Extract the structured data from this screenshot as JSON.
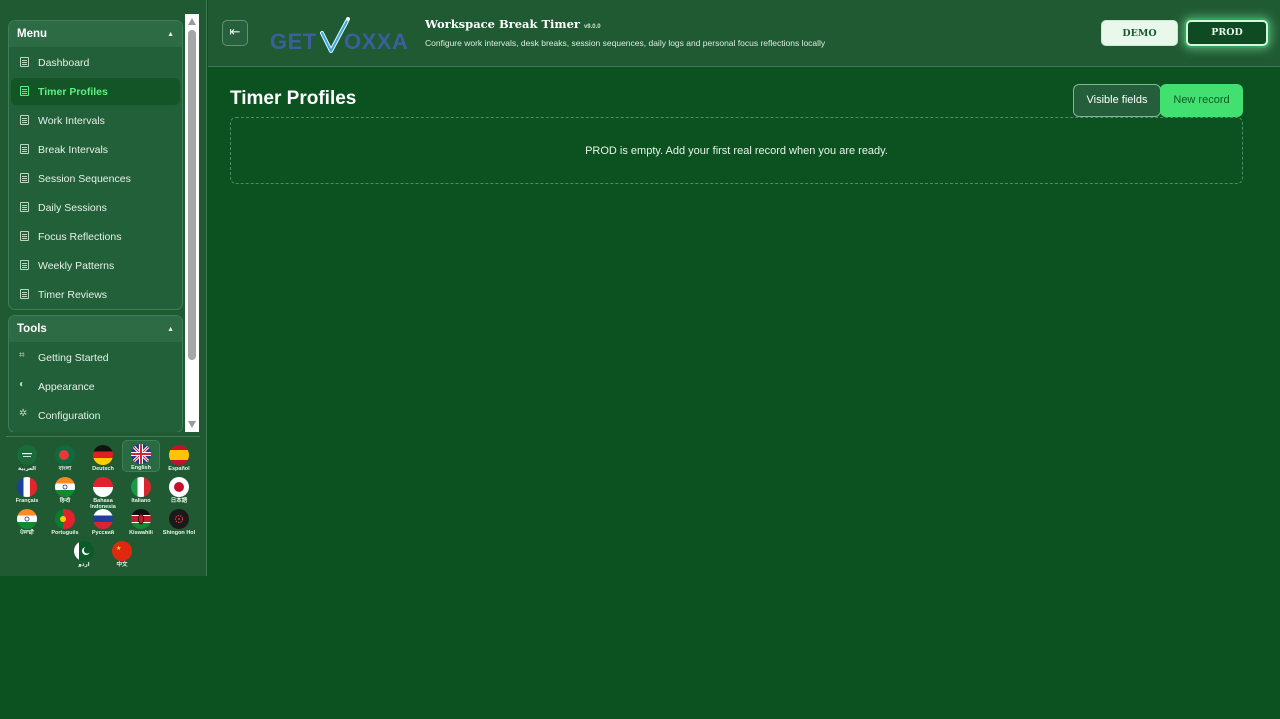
{
  "sidebar": {
    "menu": {
      "title": "Menu",
      "items": [
        {
          "label": "Dashboard"
        },
        {
          "label": "Timer Profiles",
          "active": true
        },
        {
          "label": "Work Intervals"
        },
        {
          "label": "Break Intervals"
        },
        {
          "label": "Session Sequences"
        },
        {
          "label": "Daily Sessions"
        },
        {
          "label": "Focus Reflections"
        },
        {
          "label": "Weekly Patterns"
        },
        {
          "label": "Timer Reviews"
        }
      ]
    },
    "tools": {
      "title": "Tools",
      "items": [
        {
          "label": "Getting Started",
          "icon": "start-icon"
        },
        {
          "label": "Appearance",
          "icon": "palette-icon"
        },
        {
          "label": "Configuration",
          "icon": "gear-icon"
        }
      ]
    },
    "languages": [
      {
        "label": "العربية",
        "flag": "saudi-arabia"
      },
      {
        "label": "বাংলা",
        "flag": "bangladesh"
      },
      {
        "label": "Deutsch",
        "flag": "germany"
      },
      {
        "label": "English",
        "flag": "united-kingdom",
        "active": true
      },
      {
        "label": "Español",
        "flag": "spain"
      },
      {
        "label": "Français",
        "flag": "france"
      },
      {
        "label": "हिन्दी",
        "flag": "india"
      },
      {
        "label": "Bahasa Indonesia",
        "flag": "indonesia"
      },
      {
        "label": "Italiano",
        "flag": "italy"
      },
      {
        "label": "日本語",
        "flag": "japan"
      },
      {
        "label": "ਪੰਜਾਬੀ",
        "flag": "india"
      },
      {
        "label": "Português",
        "flag": "portugal"
      },
      {
        "label": "Русский",
        "flag": "russia"
      },
      {
        "label": "Kiswahili",
        "flag": "kenya"
      },
      {
        "label": "Shingon Hol",
        "flag": "other"
      },
      {
        "label": "اردو",
        "flag": "pakistan"
      },
      {
        "label": "中文",
        "flag": "china"
      }
    ]
  },
  "header": {
    "logo_text": "GETVOXXA",
    "app_title": "Workspace Break Timer",
    "version": "v9.0.0",
    "subtitle": "Configure work intervals, desk breaks, session sequences, daily logs and personal focus reflections locally",
    "demo_label": "DEMO",
    "prod_label": "PROD",
    "active_env": "PROD"
  },
  "main": {
    "title": "Timer Profiles",
    "visible_fields_label": "Visible fields",
    "new_record_label": "New record",
    "empty_message": "PROD is empty. Add your first real record when you are ready."
  },
  "colors": {
    "background": "#0b5220",
    "sidebar": "#1f5a33",
    "accent": "#41e070",
    "active_text": "#5ef07f"
  }
}
